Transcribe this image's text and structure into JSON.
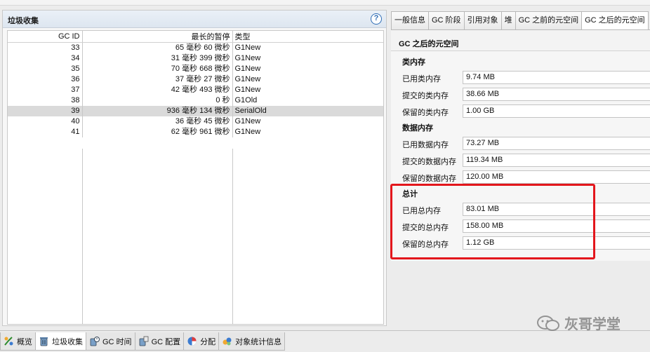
{
  "left_panel": {
    "title": "垃圾收集",
    "help": "?",
    "columns": [
      "GC ID",
      "最长的暂停",
      "类型"
    ],
    "rows": [
      {
        "id": "33",
        "pause": "65 毫秒 60 微秒",
        "type": "G1New"
      },
      {
        "id": "34",
        "pause": "31 毫秒 399 微秒",
        "type": "G1New"
      },
      {
        "id": "35",
        "pause": "70 毫秒 668 微秒",
        "type": "G1New"
      },
      {
        "id": "36",
        "pause": "37 毫秒 27 微秒",
        "type": "G1New"
      },
      {
        "id": "37",
        "pause": "42 毫秒 493 微秒",
        "type": "G1New"
      },
      {
        "id": "38",
        "pause": "0 秒",
        "type": "G1Old"
      },
      {
        "id": "39",
        "pause": "936 毫秒 134 微秒",
        "type": "SerialOld"
      },
      {
        "id": "40",
        "pause": "36 毫秒 45 微秒",
        "type": "G1New"
      },
      {
        "id": "41",
        "pause": "62 毫秒 961 微秒",
        "type": "G1New"
      }
    ],
    "selected_row_id": "39"
  },
  "right_tabs": [
    "一般信息",
    "GC 阶段",
    "引用对象",
    "堆",
    "GC 之前的元空间",
    "GC 之后的元空间"
  ],
  "right_tabs_active": "GC 之后的元空间",
  "right_panel": {
    "title": "GC 之后的元空间",
    "sections": [
      {
        "title": "类内存",
        "rows": [
          {
            "label": "已用类内存",
            "value": "9.74 MB"
          },
          {
            "label": "提交的类内存",
            "value": "38.66 MB"
          },
          {
            "label": "保留的类内存",
            "value": "1.00 GB"
          }
        ]
      },
      {
        "title": "数据内存",
        "rows": [
          {
            "label": "已用数据内存",
            "value": "73.27 MB"
          },
          {
            "label": "提交的数据内存",
            "value": "119.34 MB"
          },
          {
            "label": "保留的数据内存",
            "value": "120.00 MB"
          }
        ]
      },
      {
        "title": "总计",
        "rows": [
          {
            "label": "已用总内存",
            "value": "83.01 MB"
          },
          {
            "label": "提交的总内存",
            "value": "158.00 MB"
          },
          {
            "label": "保留的总内存",
            "value": "1.12 GB"
          }
        ]
      }
    ]
  },
  "bottom_tabs": [
    {
      "label": "概览",
      "icon": "overview-icon"
    },
    {
      "label": "垃圾收集",
      "icon": "trash-icon"
    },
    {
      "label": "GC 时间",
      "icon": "gc-time-icon"
    },
    {
      "label": "GC 配置",
      "icon": "gc-config-icon"
    },
    {
      "label": "分配",
      "icon": "pie-icon"
    },
    {
      "label": "对象统计信息",
      "icon": "objects-icon"
    }
  ],
  "bottom_tabs_active": "垃圾收集",
  "watermark": "灰哥学堂",
  "colors": {
    "highlight": "#e3161c",
    "selected_row": "#dadada",
    "help": "#2f6db5"
  }
}
